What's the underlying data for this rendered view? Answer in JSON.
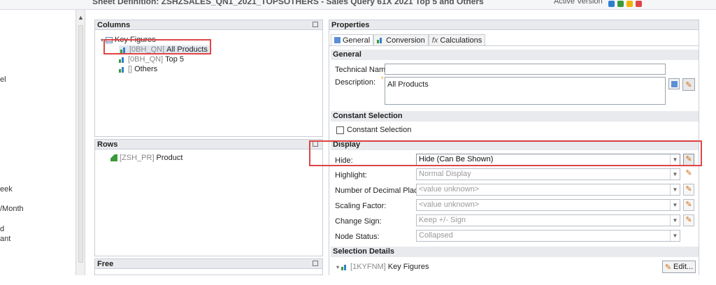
{
  "topbar": {
    "title": "Sheet Definition: ZSHZSALES_QN1_2021_TOPSOTHERS - Sales Query 61X 2021 Top 5 and Others",
    "version_label": "Active Version",
    "icon_colors": [
      "#2f7fd0",
      "#3a9a3a",
      "#f0b400",
      "#e04444"
    ]
  },
  "left_panel": {
    "fragments": [
      "el",
      "eek",
      "/Month",
      "d",
      "ant"
    ]
  },
  "columns": {
    "header": "Columns",
    "root": "Key Figures",
    "items": [
      {
        "tech": "[0BH_QN]",
        "label": "All Products"
      },
      {
        "tech": "[0BH_QN]",
        "label": "Top 5"
      },
      {
        "tech": "[]",
        "label": "Others"
      }
    ]
  },
  "rows": {
    "header": "Rows",
    "items": [
      {
        "tech": "[ZSH_PR]",
        "label": "Product"
      }
    ]
  },
  "free": {
    "header": "Free"
  },
  "properties": {
    "header": "Properties",
    "tabs": [
      "General",
      "Conversion",
      "Calculations"
    ],
    "general": {
      "header": "General",
      "technical_name_label": "Technical Name:",
      "technical_name_value": "",
      "description_label": "Description:",
      "description_value": "All Products"
    },
    "constant_selection": {
      "header": "Constant Selection",
      "checkbox_label": "Constant Selection"
    },
    "display": {
      "header": "Display",
      "fields": [
        {
          "label": "Hide:",
          "value": "Hide (Can Be Shown)"
        },
        {
          "label": "Highlight:",
          "value": "Normal Display"
        },
        {
          "label": "Number of Decimal Places:",
          "value": "<value unknown>"
        },
        {
          "label": "Scaling Factor:",
          "value": "<value unknown>"
        },
        {
          "label": "Change Sign:",
          "value": "Keep +/- Sign"
        },
        {
          "label": "Node Status:",
          "value": "Collapsed"
        }
      ]
    },
    "selection_details": {
      "header": "Selection Details",
      "tech": "[1KYFNM]",
      "label": "Key Figures",
      "edit_label": "Edit..."
    }
  }
}
